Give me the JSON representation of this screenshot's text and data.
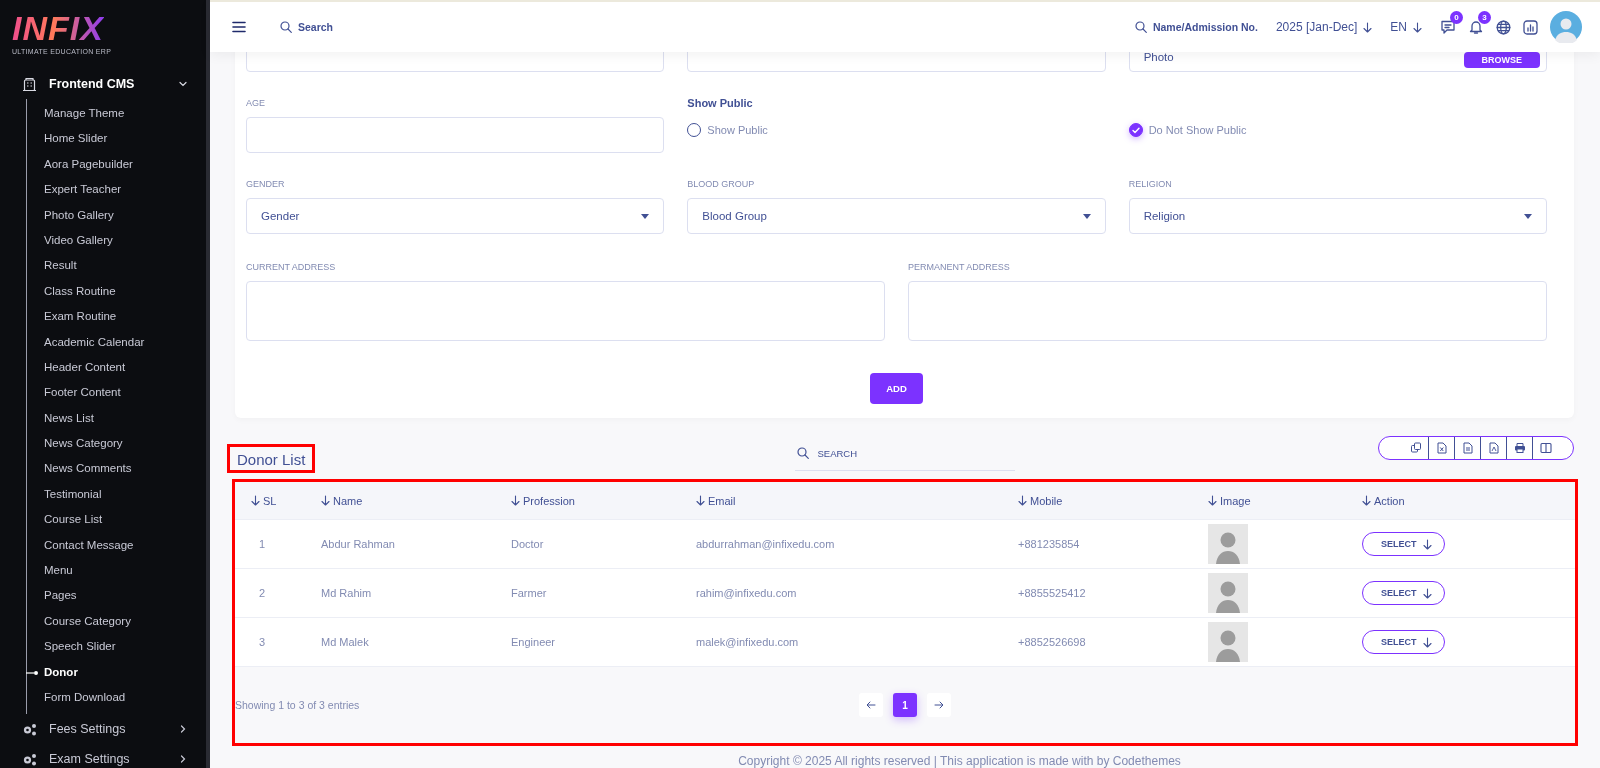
{
  "logo": {
    "name": "INFIX",
    "tagline": "ULTIMATE EDUCATION ERP"
  },
  "sidebar": {
    "items": [
      {
        "label": "Frontend CMS",
        "kind": "building",
        "expanded": true,
        "children": [
          {
            "label": "Manage Theme",
            "selected": false
          },
          {
            "label": "Home Slider",
            "selected": false
          },
          {
            "label": "Aora Pagebuilder",
            "selected": false
          },
          {
            "label": "Expert Teacher",
            "selected": false
          },
          {
            "label": "Photo Gallery",
            "selected": false
          },
          {
            "label": "Video Gallery",
            "selected": false
          },
          {
            "label": "Result",
            "selected": false
          },
          {
            "label": "Class Routine",
            "selected": false
          },
          {
            "label": "Exam Routine",
            "selected": false
          },
          {
            "label": "Academic Calendar",
            "selected": false
          },
          {
            "label": "Header Content",
            "selected": false
          },
          {
            "label": "Footer Content",
            "selected": false
          },
          {
            "label": "News List",
            "selected": false
          },
          {
            "label": "News Category",
            "selected": false
          },
          {
            "label": "News Comments",
            "selected": false
          },
          {
            "label": "Testimonial",
            "selected": false
          },
          {
            "label": "Course List",
            "selected": false
          },
          {
            "label": "Contact Message",
            "selected": false
          },
          {
            "label": "Menu",
            "selected": false
          },
          {
            "label": "Pages",
            "selected": false
          },
          {
            "label": "Course Category",
            "selected": false
          },
          {
            "label": "Speech Slider",
            "selected": false
          },
          {
            "label": "Donor",
            "selected": true
          },
          {
            "label": "Form Download",
            "selected": false
          }
        ]
      },
      {
        "label": "Fees Settings",
        "kind": "gears",
        "expanded": false
      },
      {
        "label": "Exam Settings",
        "kind": "gears",
        "expanded": false
      }
    ]
  },
  "topbar": {
    "search_placeholder": "Search",
    "student_search_placeholder": "Name/Admission No.",
    "session": "2025 [Jan-Dec]",
    "language": "EN",
    "message_count": "0",
    "notification_count": "3"
  },
  "form": {
    "top_fields": [
      {
        "kind": "input"
      },
      {
        "kind": "input"
      },
      {
        "kind": "file",
        "placeholder": "Photo",
        "button": "BROWSE"
      }
    ],
    "age": {
      "label": "AGE"
    },
    "show_public": {
      "label": "Show Public",
      "options": [
        {
          "label": "Show Public",
          "selected": false
        },
        {
          "label": "Do Not Show Public",
          "selected": true
        }
      ]
    },
    "selects": [
      {
        "label": "GENDER",
        "placeholder": "Gender"
      },
      {
        "label": "BLOOD GROUP",
        "placeholder": "Blood Group"
      },
      {
        "label": "RELIGION",
        "placeholder": "Religion"
      }
    ],
    "addresses": [
      {
        "label": "CURRENT ADDRESS"
      },
      {
        "label": "PERMANENT ADDRESS"
      }
    ],
    "submit": "ADD"
  },
  "donor_list": {
    "title": "Donor List",
    "title_highlighted": true,
    "table_highlighted": true,
    "search_placeholder": "SEARCH",
    "export_buttons": [
      {
        "kind": "copy"
      },
      {
        "kind": "excel"
      },
      {
        "kind": "csv"
      },
      {
        "kind": "pdf"
      },
      {
        "kind": "print"
      },
      {
        "kind": "columns"
      }
    ],
    "columns": [
      "SL",
      "Name",
      "Profession",
      "Email",
      "Mobile",
      "Image",
      "Action"
    ],
    "rows": [
      {
        "sl": "1",
        "name": "Abdur Rahman",
        "profession": "Doctor",
        "email": "abdurrahman@infixedu.com",
        "mobile": "+881235854",
        "action": "SELECT"
      },
      {
        "sl": "2",
        "name": "Md Rahim",
        "profession": "Farmer",
        "email": "rahim@infixedu.com",
        "mobile": "+8855525412",
        "action": "SELECT"
      },
      {
        "sl": "3",
        "name": "Md Malek",
        "profession": "Engineer",
        "email": "malek@infixedu.com",
        "mobile": "+8852526698",
        "action": "SELECT"
      }
    ],
    "info": "Showing 1 to 3 of 3 entries",
    "pages": [
      {
        "label": "1",
        "selected": true
      }
    ]
  },
  "footer": "Copyright © 2025 All rights reserved | This application is made with by Codethemes"
}
